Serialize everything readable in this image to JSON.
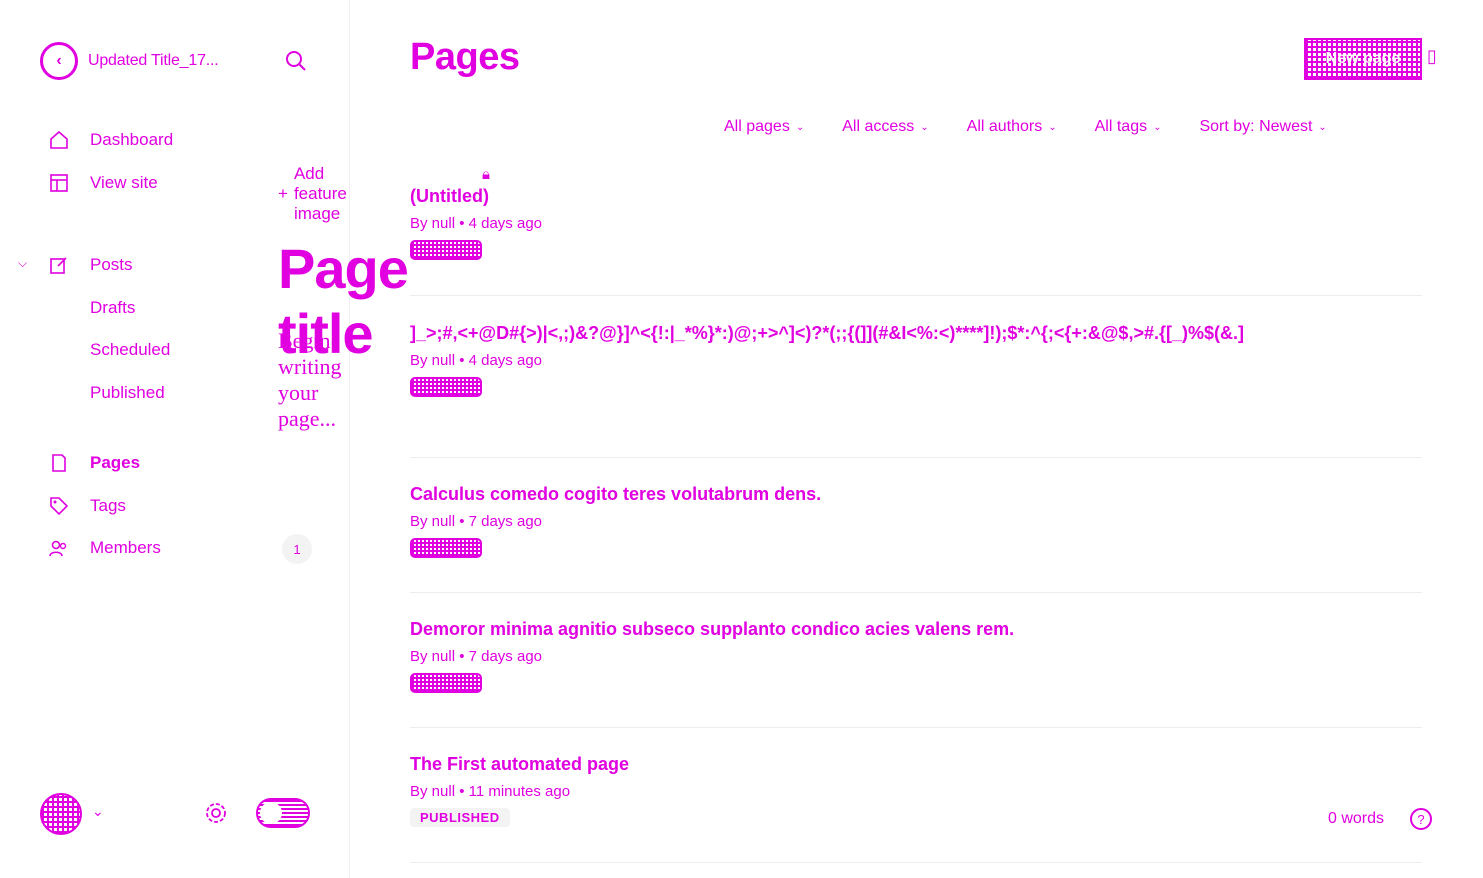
{
  "sidebar": {
    "site_title": "Updated Title_17...",
    "nav": [
      {
        "label": "Dashboard",
        "icon": "home-icon"
      },
      {
        "label": "View site",
        "icon": "layout-icon"
      },
      {
        "label": "Posts",
        "icon": "edit-icon"
      },
      {
        "label": "Pages",
        "icon": "file-icon"
      },
      {
        "label": "Tags",
        "icon": "tag-icon"
      },
      {
        "label": "Members",
        "icon": "users-icon"
      }
    ],
    "posts_sub": [
      "Drafts",
      "Scheduled",
      "Published"
    ],
    "members_count": "1"
  },
  "header": {
    "title": "Pages",
    "new_page_label": "New page"
  },
  "filters": [
    {
      "label": "All pages"
    },
    {
      "label": "All access"
    },
    {
      "label": "All authors"
    },
    {
      "label": "All tags"
    },
    {
      "label": "Sort by: Newest"
    }
  ],
  "pages": [
    {
      "title": "(Untitled)",
      "meta": "By null • 4 days ago",
      "status": ""
    },
    {
      "title": "]_>;#,<+@D#{>)|<,;)&?@}]^<{!:|_*%}*:)@;+>^]<)?*(;;{(]](#&I<%:<)****]!);$*:^{;<{+:&@$,>#.{[_)%$(&.]",
      "meta": "By null • 4 days ago",
      "status": ""
    },
    {
      "title": "Calculus comedo cogito teres volutabrum dens.",
      "meta": "By null • 7 days ago",
      "status": ""
    },
    {
      "title": "Demoror minima agnitio subseco supplanto condico acies valens rem.",
      "meta": "By null • 7 days ago",
      "status": ""
    },
    {
      "title": "The First automated page",
      "meta": "By null • 11 minutes ago",
      "status": "PUBLISHED"
    }
  ],
  "footer": {
    "words": "0 words",
    "help": "?"
  },
  "editor_overlay": {
    "add_feature": "Add feature image",
    "title_placeholder": "Page title",
    "body_placeholder": "Begin writing your page..."
  },
  "colors": {
    "accent": "#e000e0"
  }
}
